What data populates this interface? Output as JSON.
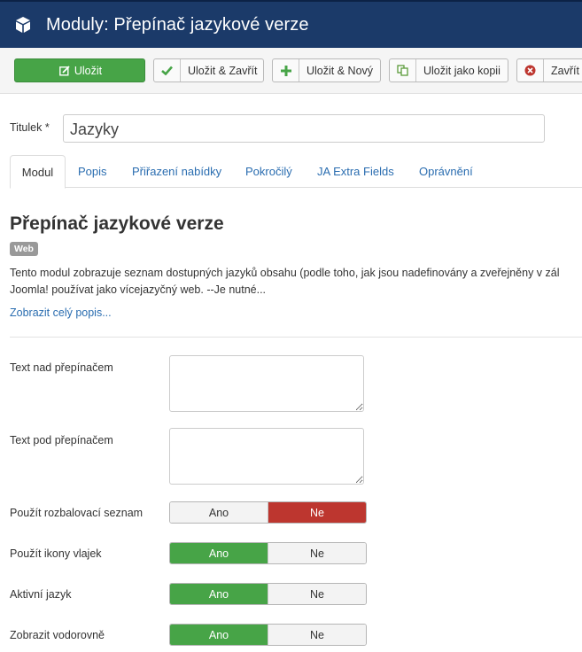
{
  "header": {
    "title": "Moduly: Přepínač jazykové verze",
    "icon": "cube-icon"
  },
  "toolbar": {
    "save": "Uložit",
    "save_close": "Uložit & Zavřít",
    "save_new": "Uložit & Nový",
    "save_copy": "Uložit jako kopii",
    "close": "Zavřít"
  },
  "form": {
    "title_label": "Titulek *",
    "title_value": "Jazyky"
  },
  "tabs": [
    "Modul",
    "Popis",
    "Přiřazení nabídky",
    "Pokročilý",
    "JA Extra Fields",
    "Oprávnění"
  ],
  "module": {
    "heading": "Přepínač jazykové verze",
    "badge": "Web",
    "desc_line1": "Tento modul zobrazuje seznam dostupných jazyků obsahu (podle toho, jak jsou nadefinovány a zveřejněny v zál",
    "desc_line2": "Joomla! používat jako vícejazyčný web. --Je nutné...",
    "more_link": "Zobrazit celý popis..."
  },
  "fields": {
    "text_above_label": "Text nad přepínačem",
    "text_above_value": "",
    "text_below_label": "Text pod přepínačem",
    "text_below_value": "",
    "dropdown_label": "Použít rozbalovací seznam",
    "flags_label": "Použít ikony vlajek",
    "active_label": "Aktivní jazyk",
    "horizontal_label": "Zobrazit vodorovně",
    "yes": "Ano",
    "no": "Ne"
  },
  "toggle_states": {
    "dropdown": "Ne",
    "flags": "Ano",
    "active": "Ano",
    "horizontal": "Ano"
  },
  "colors": {
    "header_bg": "#1b3a69",
    "save_green": "#47a447",
    "no_red": "#bd362f",
    "link_blue": "#2a6db0"
  }
}
